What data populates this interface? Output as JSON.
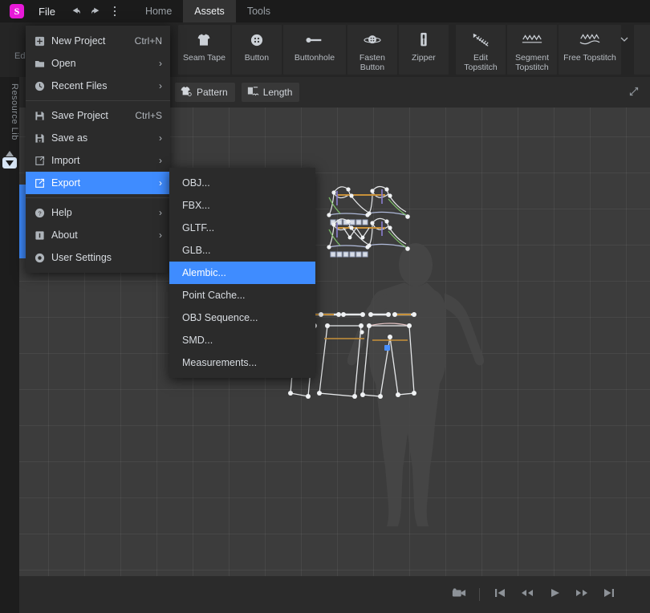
{
  "titlebar": {
    "logo_text": "S",
    "logo_color": "#e819d8",
    "file_label": "File",
    "undo_icon": "undo-arrow-icon",
    "redo_icon": "redo-arrow-icon",
    "kebab_icon": "more-options-icon",
    "tabs": [
      {
        "label": "Home",
        "active": false
      },
      {
        "label": "Assets",
        "active": true
      },
      {
        "label": "Tools",
        "active": false
      }
    ]
  },
  "toolbar": {
    "group1": [
      {
        "label": "Seam Tape",
        "icon": "tshirt-icon"
      },
      {
        "label": "Button",
        "icon": "button-circle-icon"
      },
      {
        "label": "Buttonhole",
        "icon": "buttonhole-line-icon"
      },
      {
        "label": "Fasten\nButton",
        "icon": "fasten-button-icon"
      },
      {
        "label": "Zipper",
        "icon": "zipper-icon"
      }
    ],
    "group2": [
      {
        "label": "Edit\nTopstitch",
        "icon": "edit-topstitch-icon"
      },
      {
        "label": "Segment\nTopstitch",
        "icon": "segment-topstitch-icon"
      },
      {
        "label": "Free Topstitch",
        "icon": "free-topstitch-icon"
      }
    ],
    "dropdown_caret": "chevron-down-icon",
    "cutoff_label": "Ed"
  },
  "subbar": {
    "chips": [
      {
        "label": "Pattern",
        "icon": "pattern-icon"
      },
      {
        "label": "Length",
        "icon": "length-icon"
      }
    ],
    "expand_icon": "expand-diagonal-icon"
  },
  "left_rail": {
    "label": "Resource Lib",
    "up_icon": "triangle-up-icon",
    "down_icon": "triangle-down-icon"
  },
  "file_menu": {
    "items": [
      {
        "icon": "new-project-icon",
        "label": "New Project",
        "accel": "Ctrl+N",
        "arrow": "",
        "selected": false
      },
      {
        "icon": "folder-icon",
        "label": "Open",
        "accel": "",
        "arrow": "›",
        "selected": false
      },
      {
        "icon": "clock-icon",
        "label": "Recent Files",
        "accel": "",
        "arrow": "›",
        "selected": false
      },
      {
        "separator": true
      },
      {
        "icon": "save-floppy-icon",
        "label": "Save Project",
        "accel": "Ctrl+S",
        "arrow": "",
        "selected": false
      },
      {
        "icon": "save-as-icon",
        "label": "Save as",
        "accel": "",
        "arrow": "›",
        "selected": false
      },
      {
        "icon": "import-icon",
        "label": "Import",
        "accel": "",
        "arrow": "›",
        "selected": false
      },
      {
        "icon": "export-icon",
        "label": "Export",
        "accel": "",
        "arrow": "›",
        "selected": true
      },
      {
        "separator": true
      },
      {
        "icon": "help-icon",
        "label": "Help",
        "accel": "",
        "arrow": "›",
        "selected": false
      },
      {
        "icon": "about-icon",
        "label": "About",
        "accel": "",
        "arrow": "›",
        "selected": false
      },
      {
        "icon": "user-settings-icon",
        "label": "User Settings",
        "accel": "",
        "arrow": "",
        "selected": false
      }
    ]
  },
  "export_menu": {
    "items": [
      {
        "label": "OBJ...",
        "selected": false
      },
      {
        "label": "FBX...",
        "selected": false
      },
      {
        "label": "GLTF...",
        "selected": false
      },
      {
        "label": "GLB...",
        "selected": false
      },
      {
        "label": "Alembic...",
        "selected": true
      },
      {
        "label": "Point Cache...",
        "selected": false
      },
      {
        "label": "OBJ Sequence...",
        "selected": false
      },
      {
        "label": "SMD...",
        "selected": false
      },
      {
        "label": "Measurements...",
        "selected": false
      }
    ]
  },
  "playbar": {
    "buttons": [
      {
        "icon": "record-camera-icon",
        "name": "record-camera-button"
      },
      {
        "separator": true
      },
      {
        "icon": "skip-back-icon",
        "name": "skip-to-start-button"
      },
      {
        "icon": "rewind-icon",
        "name": "rewind-button"
      },
      {
        "icon": "play-icon",
        "name": "play-button"
      },
      {
        "icon": "fast-forward-icon",
        "name": "fast-forward-button"
      },
      {
        "icon": "skip-forward-icon",
        "name": "skip-to-end-button"
      }
    ]
  },
  "viewport": {
    "background_color": "#3c3c3c",
    "grid_size_px": 45,
    "accent_color": "#3f8cff",
    "selected_point_color": "#4a90ff",
    "seam_color": "#c8913a"
  }
}
